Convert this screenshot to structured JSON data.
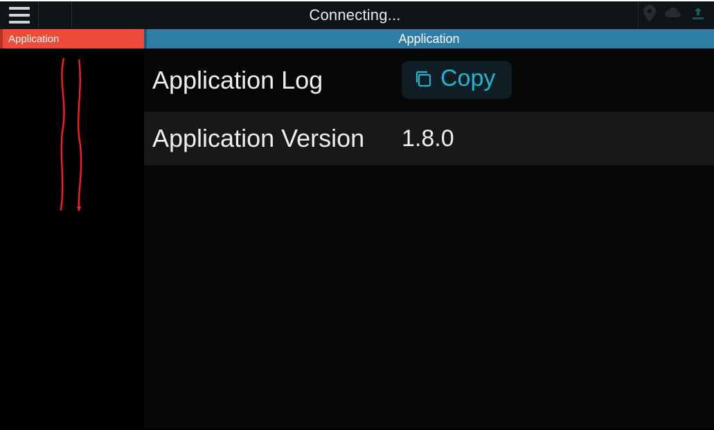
{
  "titlebar": {
    "status_text": "Connecting..."
  },
  "tabs": {
    "left_label": "Application",
    "right_label": "Application"
  },
  "content": {
    "rows": [
      {
        "label": "Application Log",
        "action_label": "Copy"
      },
      {
        "label": "Application Version",
        "value": "1.8.0"
      }
    ]
  }
}
